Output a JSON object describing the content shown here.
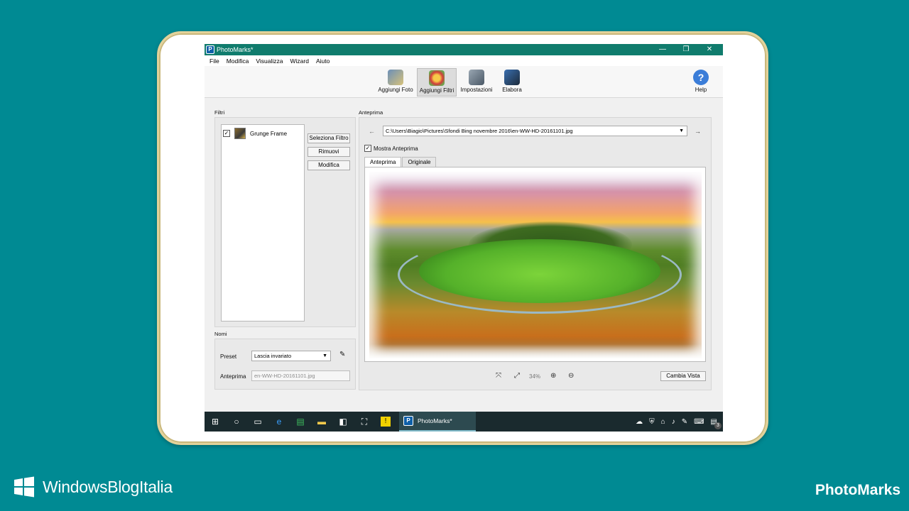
{
  "window": {
    "title": "PhotoMarks*",
    "minimize": "—",
    "restore": "❐",
    "close": "✕"
  },
  "menu": [
    "File",
    "Modifica",
    "Visualizza",
    "Wizard",
    "Aiuto"
  ],
  "toolbar": {
    "add_photo": "Aggiungi Foto",
    "add_filters": "Aggiungi Filtri",
    "settings": "Impostazioni",
    "process": "Elabora",
    "help": "Help"
  },
  "filters": {
    "label": "Filtri",
    "items": [
      {
        "name": "Grunge Frame",
        "checked": "✓"
      }
    ],
    "select_button": "Seleziona Filtro",
    "remove_button": "Rimuovi",
    "edit_button": "Modifica"
  },
  "names": {
    "label": "Nomi",
    "preset_label": "Preset",
    "preset_value": "Lascia invariato",
    "preview_label": "Anteprima",
    "preview_value": "en-WW-HD-20161101.jpg"
  },
  "preview": {
    "label": "Anteprima",
    "path": "C:\\Users\\Biagio\\Pictures\\Sfondi Bing novembre 2016\\en-WW-HD-20161101.jpg",
    "show_preview_label": "Mostra Anteprima",
    "show_preview_checked": "✓",
    "tabs": [
      "Anteprima",
      "Originale"
    ],
    "zoom": "34%",
    "change_view_button": "Cambia Vista"
  },
  "taskbar": {
    "app_label": "PhotoMarks*",
    "notifications": "3"
  },
  "branding": {
    "left": "WindowsBlogItalia",
    "right": "PhotoMarks"
  },
  "colors": {
    "background": "#008a93",
    "titlebar": "#107c6d",
    "taskbar": "#1a2a2e"
  }
}
